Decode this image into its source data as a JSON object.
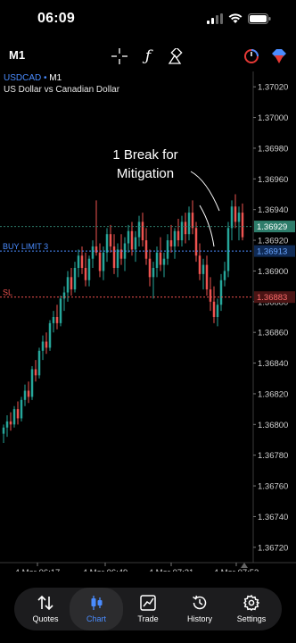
{
  "status": {
    "time": "06:09"
  },
  "toolbar": {
    "timeframe": "M1"
  },
  "symbol": {
    "name": "USDCAD",
    "sep": " • ",
    "tf": "M1",
    "description": "US Dollar vs Canadian Dollar"
  },
  "annotation": {
    "line1": "1 Break for",
    "line2": "Mitigation"
  },
  "colors": {
    "bull": "#26a69a",
    "bear": "#ef5350",
    "ask_line": "#2e7d6b",
    "order_line": "#4a8cff",
    "sl_line": "#ef5350"
  },
  "chart_data": {
    "type": "candlestick",
    "symbol": "USDCAD",
    "timeframe": "M1",
    "ylim": [
      1.3671,
      1.3703
    ],
    "yticks": [
      "1.37020",
      "1.37000",
      "1.36980",
      "1.36960",
      "1.36940",
      "1.36920",
      "1.36900",
      "1.36880",
      "1.36860",
      "1.36840",
      "1.36820",
      "1.36800",
      "1.36780",
      "1.36760",
      "1.36740",
      "1.36720"
    ],
    "xticks": [
      "4 Mar 06:17",
      "4 Mar 06:49",
      "4 Mar 07:21",
      "4 Mar 07:53"
    ],
    "price_tags": [
      {
        "label": "",
        "price": "1.36929",
        "kind": "bid"
      },
      {
        "label": "BUY LIMIT 3",
        "price": "1.36913",
        "kind": "order"
      },
      {
        "label": "SL",
        "price": "1.36883",
        "kind": "sl"
      }
    ],
    "candles": [
      [
        1.36794,
        1.368,
        1.36788,
        1.36798
      ],
      [
        1.36798,
        1.36806,
        1.36792,
        1.36802
      ],
      [
        1.36802,
        1.36808,
        1.36796,
        1.368
      ],
      [
        1.368,
        1.36812,
        1.36798,
        1.3681
      ],
      [
        1.3681,
        1.36815,
        1.368,
        1.36804
      ],
      [
        1.36804,
        1.36818,
        1.36802,
        1.36816
      ],
      [
        1.36816,
        1.36826,
        1.36812,
        1.36822
      ],
      [
        1.36822,
        1.36828,
        1.36814,
        1.36818
      ],
      [
        1.36818,
        1.36838,
        1.36816,
        1.36836
      ],
      [
        1.36836,
        1.36842,
        1.36828,
        1.36832
      ],
      [
        1.36832,
        1.3685,
        1.3683,
        1.36848
      ],
      [
        1.36848,
        1.36858,
        1.36842,
        1.36854
      ],
      [
        1.36854,
        1.3686,
        1.36846,
        1.3685
      ],
      [
        1.3685,
        1.36868,
        1.36848,
        1.36866
      ],
      [
        1.36866,
        1.36874,
        1.3686,
        1.3687
      ],
      [
        1.3687,
        1.36878,
        1.36862,
        1.36866
      ],
      [
        1.36866,
        1.36884,
        1.36864,
        1.36882
      ],
      [
        1.36882,
        1.3689,
        1.36874,
        1.36886
      ],
      [
        1.36886,
        1.369,
        1.3688,
        1.36896
      ],
      [
        1.36896,
        1.36902,
        1.36884,
        1.36888
      ],
      [
        1.36888,
        1.36906,
        1.36886,
        1.36902
      ],
      [
        1.36902,
        1.36914,
        1.36896,
        1.3691
      ],
      [
        1.3691,
        1.36916,
        1.36898,
        1.36902
      ],
      [
        1.36902,
        1.36912,
        1.3689,
        1.36894
      ],
      [
        1.36894,
        1.3691,
        1.3689,
        1.36908
      ],
      [
        1.36908,
        1.3692,
        1.36902,
        1.36916
      ],
      [
        1.36916,
        1.36946,
        1.3691,
        1.36912
      ],
      [
        1.36912,
        1.36918,
        1.36896,
        1.369
      ],
      [
        1.369,
        1.36916,
        1.36894,
        1.36912
      ],
      [
        1.36912,
        1.36928,
        1.36906,
        1.36924
      ],
      [
        1.36924,
        1.3693,
        1.36912,
        1.36916
      ],
      [
        1.36916,
        1.36924,
        1.36898,
        1.36902
      ],
      [
        1.36902,
        1.36918,
        1.36896,
        1.36914
      ],
      [
        1.36914,
        1.36924,
        1.36904,
        1.36908
      ],
      [
        1.36908,
        1.36922,
        1.369,
        1.36918
      ],
      [
        1.36918,
        1.3693,
        1.36912,
        1.36926
      ],
      [
        1.36926,
        1.36932,
        1.3691,
        1.36914
      ],
      [
        1.36914,
        1.36926,
        1.36906,
        1.36922
      ],
      [
        1.36922,
        1.36936,
        1.36916,
        1.36932
      ],
      [
        1.36932,
        1.36938,
        1.36916,
        1.3692
      ],
      [
        1.3692,
        1.36928,
        1.36904,
        1.36908
      ],
      [
        1.36908,
        1.36914,
        1.3689,
        1.36896
      ],
      [
        1.36896,
        1.36906,
        1.36882,
        1.36902
      ],
      [
        1.36902,
        1.36916,
        1.36896,
        1.36912
      ],
      [
        1.36912,
        1.36922,
        1.369,
        1.36904
      ],
      [
        1.36904,
        1.36912,
        1.36896,
        1.36908
      ],
      [
        1.36908,
        1.36924,
        1.36904,
        1.3692
      ],
      [
        1.3692,
        1.3693,
        1.36912,
        1.36916
      ],
      [
        1.36916,
        1.36928,
        1.36908,
        1.36926
      ],
      [
        1.36926,
        1.36934,
        1.36916,
        1.3692
      ],
      [
        1.3692,
        1.36936,
        1.36916,
        1.36932
      ],
      [
        1.36932,
        1.36938,
        1.36918,
        1.36924
      ],
      [
        1.36924,
        1.36942,
        1.3692,
        1.36938
      ],
      [
        1.36938,
        1.36946,
        1.36924,
        1.36928
      ],
      [
        1.36928,
        1.36932,
        1.36906,
        1.3691
      ],
      [
        1.3691,
        1.36918,
        1.36894,
        1.36898
      ],
      [
        1.36898,
        1.36908,
        1.36888,
        1.36904
      ],
      [
        1.36904,
        1.3691,
        1.36884,
        1.36888
      ],
      [
        1.36888,
        1.36896,
        1.36874,
        1.3688
      ],
      [
        1.3688,
        1.3689,
        1.36866,
        1.3687
      ],
      [
        1.3687,
        1.36882,
        1.36864,
        1.36878
      ],
      [
        1.36878,
        1.36898,
        1.36874,
        1.36894
      ],
      [
        1.36894,
        1.36906,
        1.3689,
        1.369
      ],
      [
        1.369,
        1.36932,
        1.36896,
        1.36928
      ],
      [
        1.36928,
        1.36946,
        1.3692,
        1.36942
      ],
      [
        1.36942,
        1.3695,
        1.36928,
        1.36932
      ],
      [
        1.36932,
        1.36942,
        1.3692,
        1.36938
      ],
      [
        1.36938,
        1.36944,
        1.3692,
        1.36922
      ]
    ]
  },
  "nav": [
    {
      "label": "Quotes",
      "icon": "quotes-icon"
    },
    {
      "label": "Chart",
      "icon": "chart-icon"
    },
    {
      "label": "Trade",
      "icon": "trade-icon"
    },
    {
      "label": "History",
      "icon": "history-icon"
    },
    {
      "label": "Settings",
      "icon": "settings-icon"
    }
  ]
}
